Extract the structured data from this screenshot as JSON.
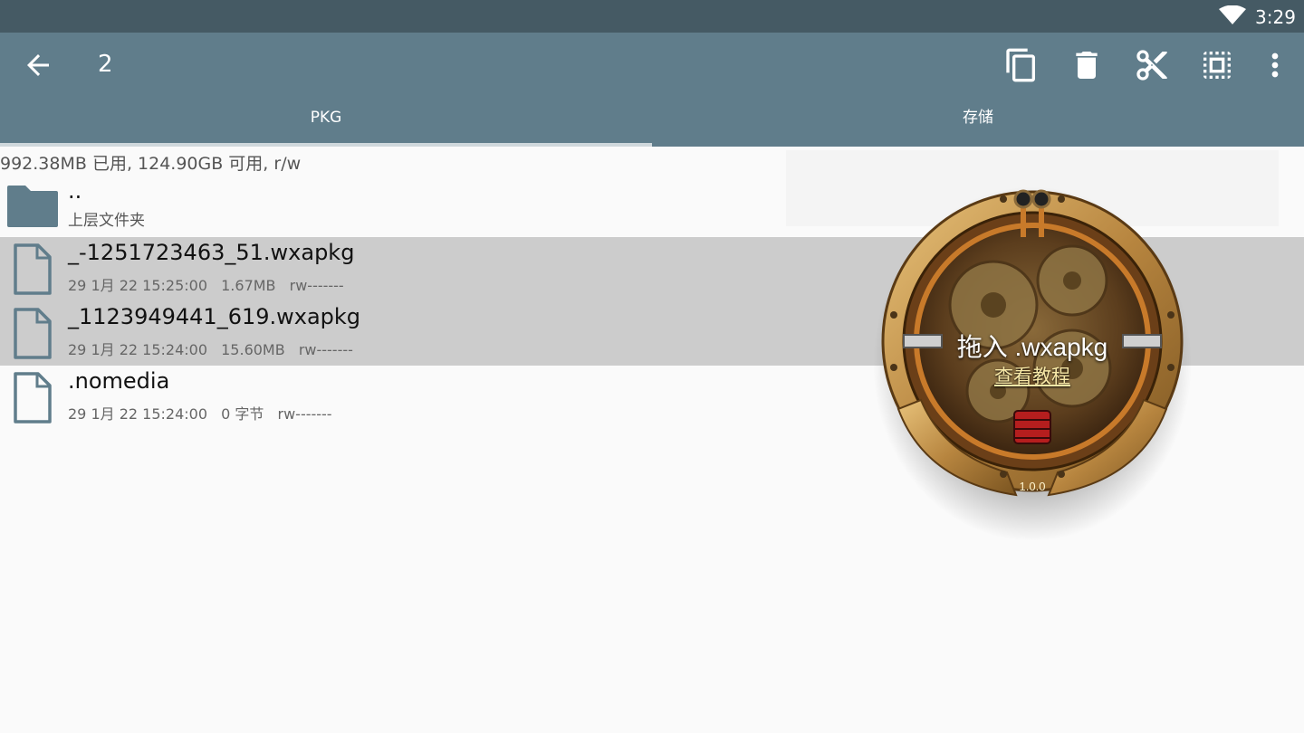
{
  "status": {
    "time": "3:29",
    "wifi_icon": "wifi-icon"
  },
  "appbar": {
    "title": "2",
    "actions": [
      "back-icon",
      "copy-icon",
      "delete-icon",
      "cut-icon",
      "select-all-icon",
      "more-vert-icon"
    ],
    "tabs": [
      {
        "label": "PKG",
        "active": true
      },
      {
        "label": "存储",
        "active": false
      }
    ],
    "color": "#607d8b"
  },
  "storage_info": "992.38MB 已用, 124.90GB 可用, r/w",
  "parent": {
    "name": "..",
    "label": "上层文件夹"
  },
  "files": [
    {
      "name": "_-1251723463_51.wxapkg",
      "date": "29 1月 22 15:25:00",
      "size": "1.67MB",
      "perm": "rw-------",
      "selected": true
    },
    {
      "name": "_1123949441_619.wxapkg",
      "date": "29 1月 22 15:24:00",
      "size": "15.60MB",
      "perm": "rw-------",
      "selected": true
    },
    {
      "name": ".nomedia",
      "date": "29 1月 22 15:24:00",
      "size": "0 字节",
      "perm": "rw-------",
      "selected": false
    }
  ],
  "overlay": {
    "drop_text": "拖入 .wxapkg",
    "tutorial_link": "查看教程",
    "version": "1.0.0"
  }
}
